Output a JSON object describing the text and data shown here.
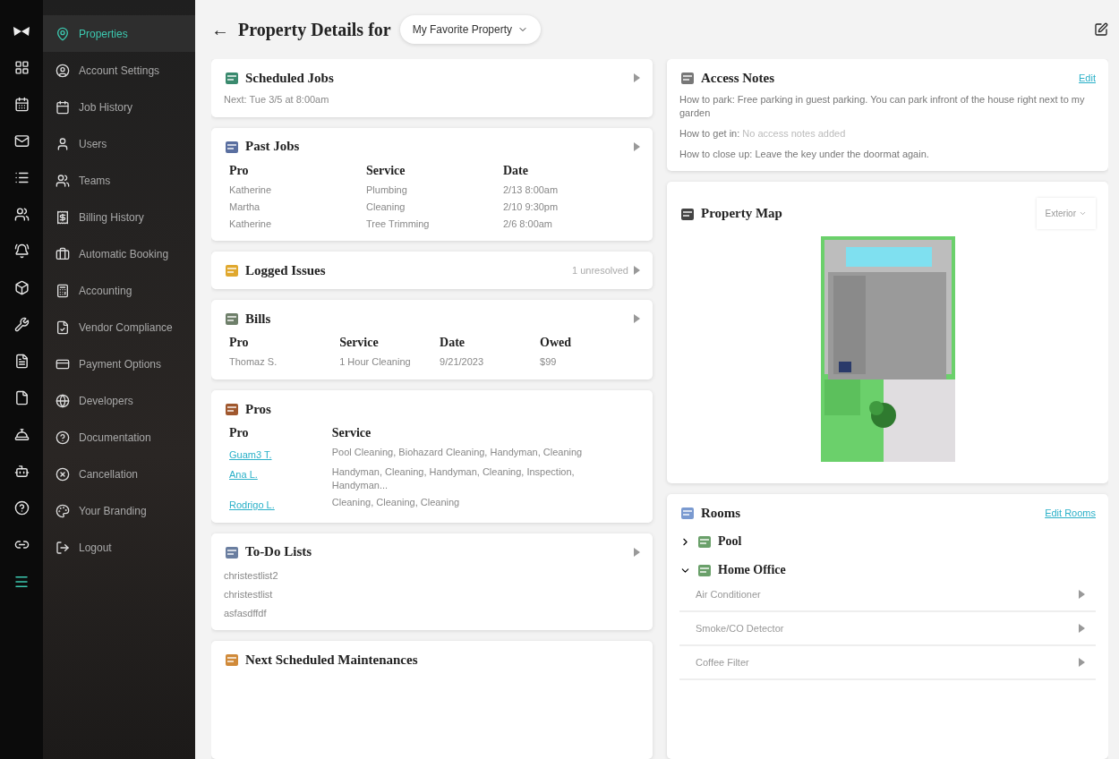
{
  "sidebar": {
    "menu": [
      {
        "label": "Properties",
        "selected": true
      },
      {
        "label": "Account Settings",
        "selected": false
      },
      {
        "label": "Job History",
        "selected": false
      },
      {
        "label": "Users",
        "selected": false
      },
      {
        "label": "Teams",
        "selected": false
      },
      {
        "label": "Billing History",
        "selected": false
      },
      {
        "label": "Automatic Booking",
        "selected": false
      },
      {
        "label": "Accounting",
        "selected": false
      },
      {
        "label": "Vendor Compliance",
        "selected": false
      },
      {
        "label": "Payment Options",
        "selected": false
      },
      {
        "label": "Developers",
        "selected": false
      },
      {
        "label": "Documentation",
        "selected": false
      },
      {
        "label": "Cancellation",
        "selected": false
      },
      {
        "label": "Your Branding",
        "selected": false
      },
      {
        "label": "Logout",
        "selected": false
      }
    ]
  },
  "header": {
    "back": "←",
    "title": "Property Details for",
    "property": "My Favorite Property"
  },
  "left_cards": [
    {
      "kind": "text",
      "title": "Scheduled Jobs",
      "arrow": true,
      "text": "Next: Tue 3/5 at 8:00am"
    },
    {
      "kind": "table",
      "title": "Past Jobs",
      "arrow": true,
      "columns": [
        "Pro",
        "Service",
        "Date"
      ],
      "rows": [
        [
          "Katherine",
          "Plumbing",
          "2/13 8:00am"
        ],
        [
          "Martha",
          "Cleaning",
          "2/10 9:30pm"
        ],
        [
          "Katherine",
          "Tree Trimming",
          "2/6 8:00am"
        ]
      ]
    },
    {
      "kind": "status",
      "title": "Logged Issues",
      "arrow": true,
      "status": "1 unresolved"
    },
    {
      "kind": "table",
      "title": "Bills",
      "arrow": true,
      "columns": [
        "Pro",
        "Service",
        "Date",
        "Owed"
      ],
      "rows": [
        [
          "Thomaz S.",
          "1 Hour Cleaning",
          "9/21/2023",
          "$99"
        ]
      ]
    },
    {
      "kind": "links",
      "title": "Pros",
      "arrow": false,
      "columns": [
        "Pro",
        "Service"
      ],
      "rows": [
        [
          "Guam3 T.",
          "Pool Cleaning, Biohazard Cleaning, Handyman, Cleaning"
        ],
        [
          "Ana L.",
          "Handyman, Cleaning, Handyman, Cleaning, Inspection, Handyman..."
        ],
        [
          "Rodrigo L.",
          "Cleaning, Cleaning, Cleaning"
        ]
      ]
    },
    {
      "kind": "list",
      "title": "To-Do Lists",
      "arrow": true,
      "items": [
        "christestlist2",
        "christestlist",
        "asfasdffdf"
      ]
    },
    {
      "kind": "header",
      "title": "Next Scheduled Maintenances",
      "arrow": false
    }
  ],
  "access_notes": {
    "title": "Access Notes",
    "edit": "Edit",
    "notes": [
      {
        "label": "How to park:",
        "value": "Free parking in guest parking. You can park infront of the house right next to my garden",
        "empty": false
      },
      {
        "label": "How to get in:",
        "value": "No access notes added",
        "empty": true
      },
      {
        "label": "How to close up:",
        "value": "Leave the key under the doormat again.",
        "empty": false
      }
    ]
  },
  "property_map": {
    "title": "Property Map",
    "view": "Exterior"
  },
  "rooms": {
    "title": "Rooms",
    "edit": "Edit Rooms",
    "items": [
      {
        "name": "Pool",
        "expanded": false
      },
      {
        "name": "Home Office",
        "expanded": true,
        "children": [
          "Air Conditioner",
          "Smoke/CO Detector",
          "Coffee Filter"
        ]
      }
    ]
  }
}
